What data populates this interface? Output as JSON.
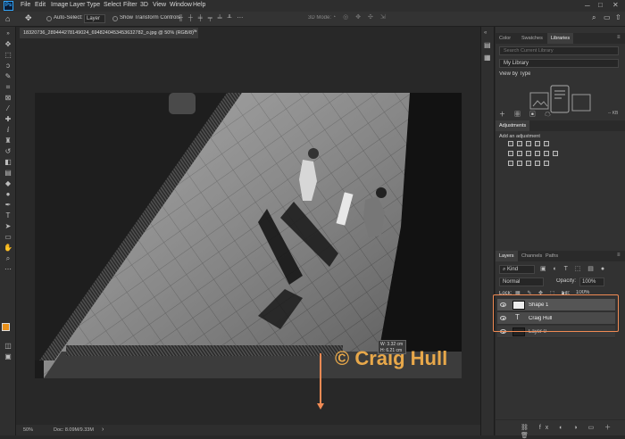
{
  "app": {
    "logo": "Ps"
  },
  "menu": [
    "File",
    "Edit",
    "Image",
    "Layer",
    "Type",
    "Select",
    "Filter",
    "3D",
    "View",
    "Window",
    "Help"
  ],
  "options_bar": {
    "auto_select": "Auto-Select:",
    "layer_select": "Layer",
    "show_transform": "Show Transform Controls",
    "mode_3d": "3D Mode:"
  },
  "document": {
    "tab_title": "18320736_289444278149024_6948240453453632782_o.jpg @ 50% (RGB/8) *",
    "zoom": "50%",
    "doc_info": "Doc: 8.09M/9.33M"
  },
  "canvas": {
    "watermark": "© Craig Hull",
    "measure_w": "W: 3.32 cm",
    "measure_h": "H: 6.21 cm"
  },
  "panels": {
    "top_tabs": [
      "Color",
      "Swatches",
      "Libraries"
    ],
    "search_placeholder": "Search Current Library",
    "library_select": "My Library",
    "view_by": "View by Type",
    "kb_label": "-- KB",
    "adjustments_title": "Adjustments",
    "adjustments_hint": "Add an adjustment",
    "layer_tabs": [
      "Layers",
      "Channels",
      "Paths"
    ],
    "kind": "Kind",
    "blend_mode": "Normal",
    "opacity_label": "Opacity:",
    "opacity_value": "100%",
    "lock_label": "Lock:",
    "fill_label": "Fill:",
    "fill_value": "100%",
    "layers": [
      {
        "name": "Shape 1",
        "type": "shape"
      },
      {
        "name": "Craig Hull",
        "type": "text"
      },
      {
        "name": "Layer 0",
        "type": "image"
      }
    ]
  },
  "colors": {
    "accent": "#f08a54",
    "watermark": "#e8a84a",
    "ps_blue": "#31a8ff"
  }
}
